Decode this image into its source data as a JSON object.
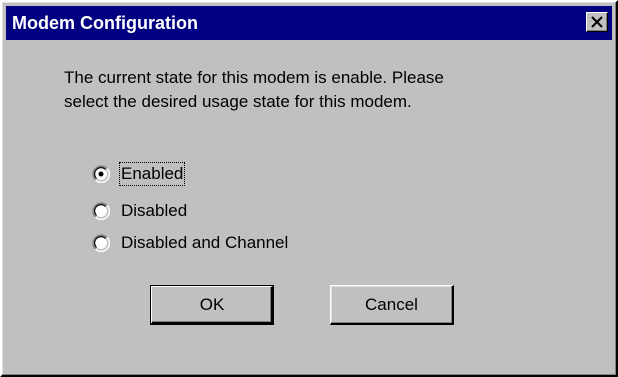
{
  "window": {
    "title": "Modem Configuration",
    "close_icon": "close-icon"
  },
  "message": {
    "line1": "The current state for this modem is enable. Please",
    "line2": "select the desired usage state for this modem."
  },
  "options": [
    {
      "label": "Enabled",
      "selected": true
    },
    {
      "label": "Disabled",
      "selected": false
    },
    {
      "label": "Disabled and Channel",
      "selected": false
    }
  ],
  "buttons": {
    "ok_label": "OK",
    "cancel_label": "Cancel"
  },
  "colors": {
    "titlebar": "#000080",
    "face": "#c0c0c0"
  }
}
